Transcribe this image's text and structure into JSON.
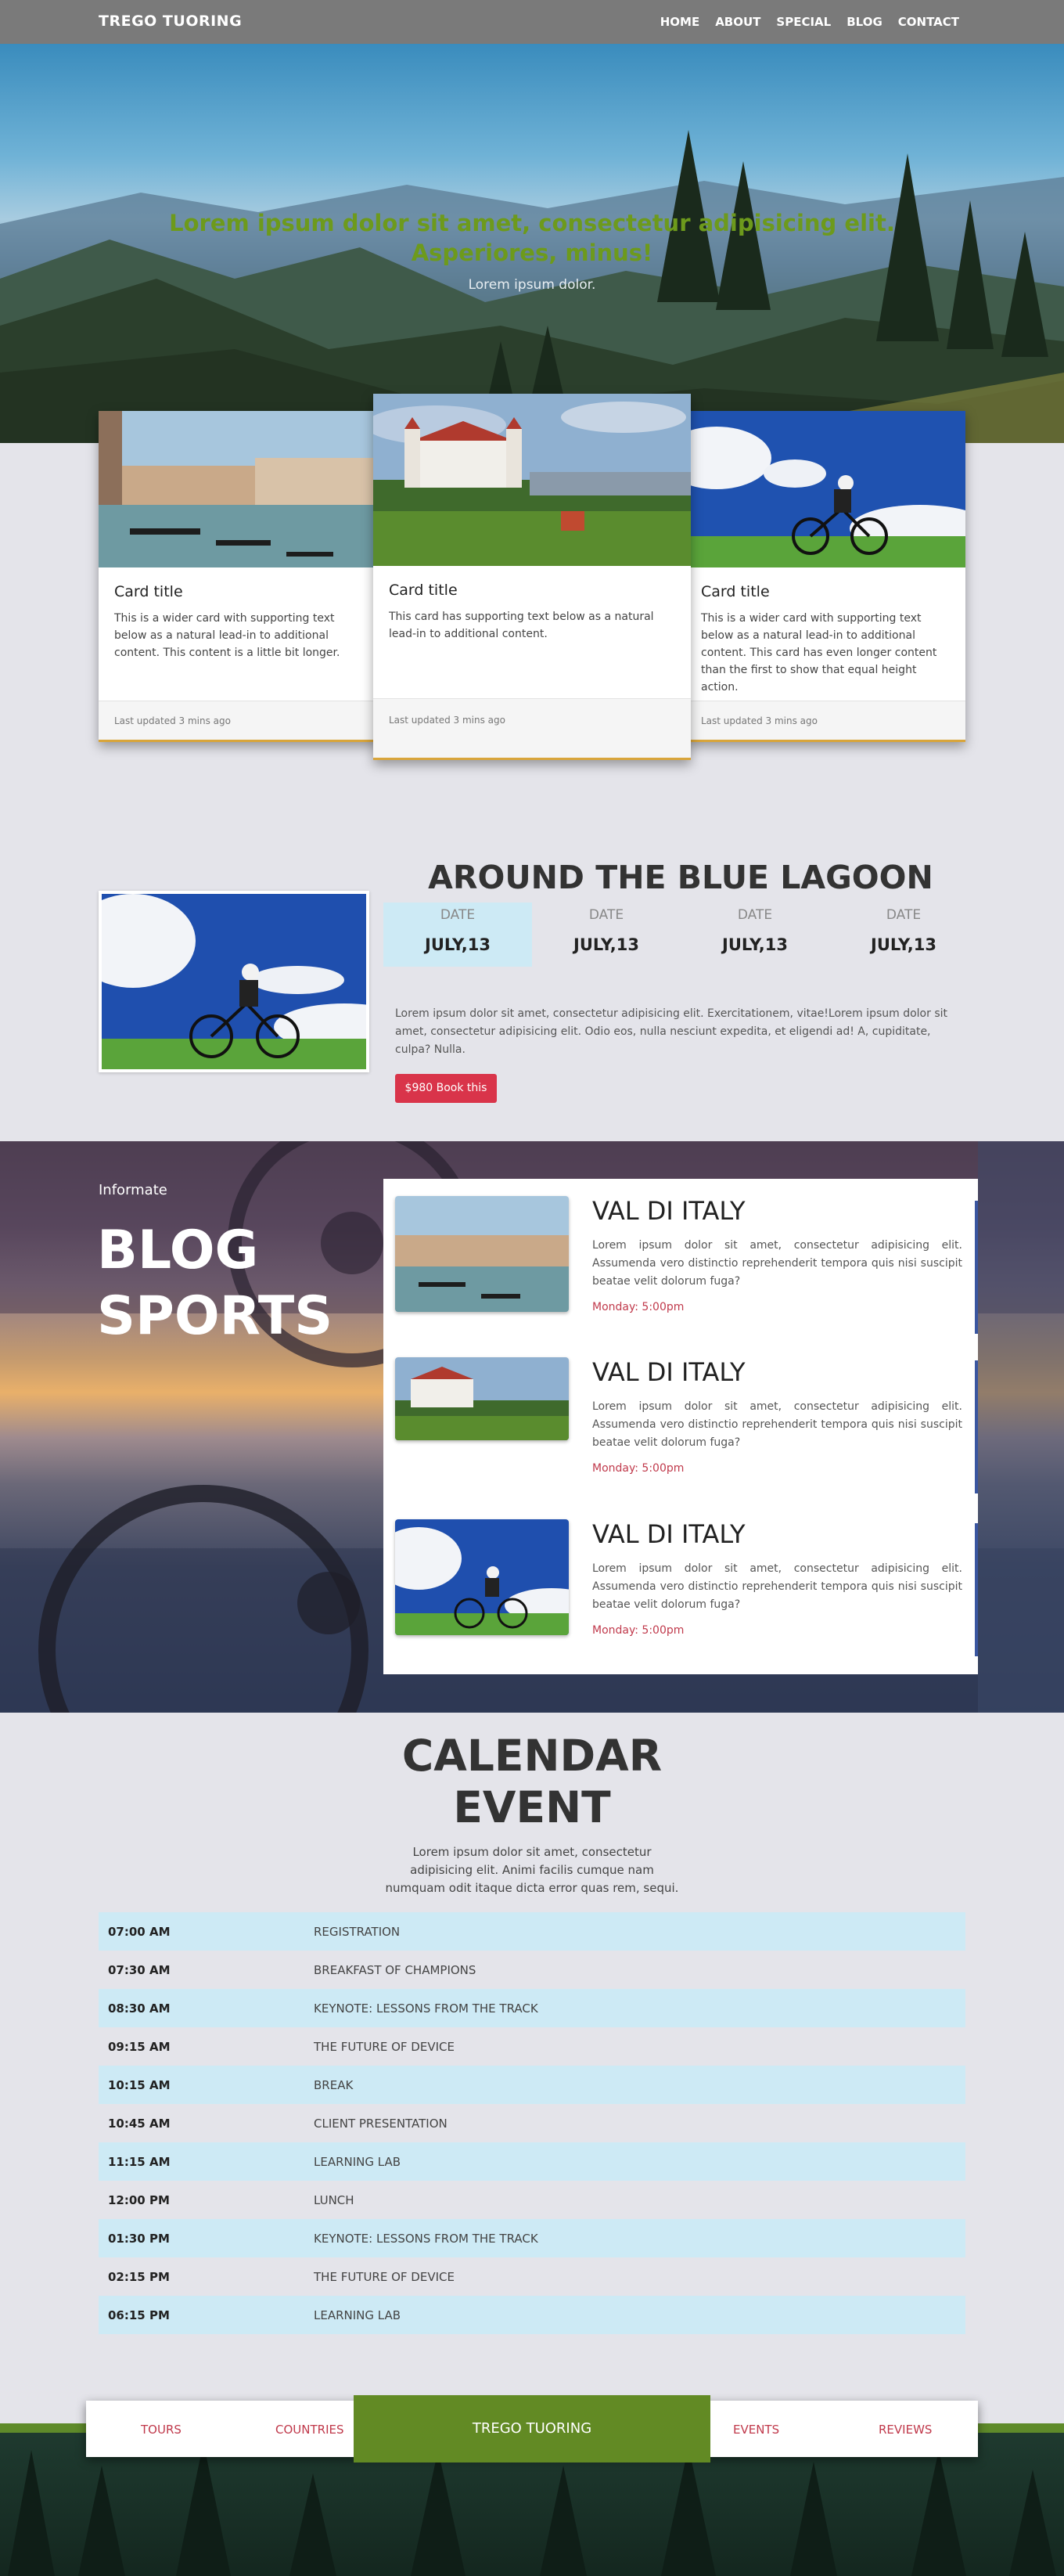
{
  "navbar": {
    "brand": "TREGO TUORING",
    "links": [
      "HOME",
      "ABOUT",
      "SPECIAL",
      "BLOG",
      "CONTACT"
    ]
  },
  "hero": {
    "title": "Lorem ipsum dolor sit amet, consectetur adipisicing elit. Asperiores, minus!",
    "subtitle": "Lorem ipsum dolor."
  },
  "cards": [
    {
      "title": "Card title",
      "text": "This is a wider card with supporting text below as a natural lead-in to additional content. This content is a little bit longer.",
      "footer": "Last updated 3 mins ago"
    },
    {
      "title": "Card title",
      "text": "This card has supporting text below as a natural lead-in to additional content.",
      "footer": "Last updated 3 mins ago"
    },
    {
      "title": "Card title",
      "text": "This is a wider card with supporting text below as a natural lead-in to additional content. This card has even longer content than the first to show that equal height action.",
      "footer": "Last updated 3 mins ago"
    }
  ],
  "lagoon": {
    "title": "AROUND THE BLUE LAGOON",
    "dates": [
      {
        "label": "DATE",
        "value": "JULY,13"
      },
      {
        "label": "DATE",
        "value": "JULY,13"
      },
      {
        "label": "DATE",
        "value": "JULY,13"
      },
      {
        "label": "DATE",
        "value": "JULY,13"
      }
    ],
    "text": "Lorem ipsum dolor sit amet, consectetur adipisicing elit. Exercitationem, vitae!Lorem ipsum dolor sit amet, consectetur adipisicing elit. Odio eos, nulla nesciunt expedita, et eligendi ad! A, cupiditate, culpa? Nulla.",
    "button": "$980 Book this"
  },
  "blog": {
    "kicker": "Informate",
    "title_line1": "BLOG",
    "title_line2": "SPORTS",
    "items": [
      {
        "title": "VAL DI ITALY",
        "text": "Lorem ipsum dolor sit amet, consectetur adipisicing elit. Assumenda vero distinctio reprehenderit tempora quis nisi suscipit beatae velit dolorum fuga?",
        "time": "Monday: 5:00pm"
      },
      {
        "title": "VAL DI ITALY",
        "text": "Lorem ipsum dolor sit amet, consectetur adipisicing elit. Assumenda vero distinctio reprehenderit tempora quis nisi suscipit beatae velit dolorum fuga?",
        "time": "Monday: 5:00pm"
      },
      {
        "title": "VAL DI ITALY",
        "text": "Lorem ipsum dolor sit amet, consectetur adipisicing elit. Assumenda vero distinctio reprehenderit tempora quis nisi suscipit beatae velit dolorum fuga?",
        "time": "Monday: 5:00pm"
      }
    ]
  },
  "calendar": {
    "title_line1": "CALENDAR",
    "title_line2": "EVENT",
    "subtitle": "Lorem ipsum dolor sit amet, consectetur adipisicing elit. Animi facilis cumque nam numquam odit itaque dicta error quas rem, sequi.",
    "rows": [
      {
        "time": "07:00 AM",
        "event": "REGISTRATION"
      },
      {
        "time": "07:30 AM",
        "event": "BREAKFAST OF CHAMPIONS"
      },
      {
        "time": "08:30 AM",
        "event": "KEYNOTE: LESSONS FROM THE TRACK"
      },
      {
        "time": "09:15 AM",
        "event": "THE FUTURE OF DEVICE"
      },
      {
        "time": "10:15 AM",
        "event": "BREAK"
      },
      {
        "time": "10:45 AM",
        "event": "CLIENT PRESENTATION"
      },
      {
        "time": "11:15 AM",
        "event": "LEARNING LAB"
      },
      {
        "time": "12:00 PM",
        "event": "LUNCH"
      },
      {
        "time": "01:30 PM",
        "event": "KEYNOTE: LESSONS FROM THE TRACK"
      },
      {
        "time": "02:15 PM",
        "event": "THE FUTURE OF DEVICE"
      },
      {
        "time": "06:15 PM",
        "event": "LEARNING LAB"
      }
    ]
  },
  "footer": {
    "items": [
      "TOURS",
      "COUNTRIES",
      "EVENTS",
      "REVIEWS"
    ],
    "brand": "TREGO TUORING"
  },
  "colors": {
    "accent_green": "#628a24",
    "accent_red": "#d9344a",
    "highlight_blue": "#cdeaf5",
    "card_border": "#d9a53a"
  },
  "icons": {
    "images": [
      "venice-canal-photo",
      "castle-photo",
      "cyclist-photo"
    ]
  }
}
